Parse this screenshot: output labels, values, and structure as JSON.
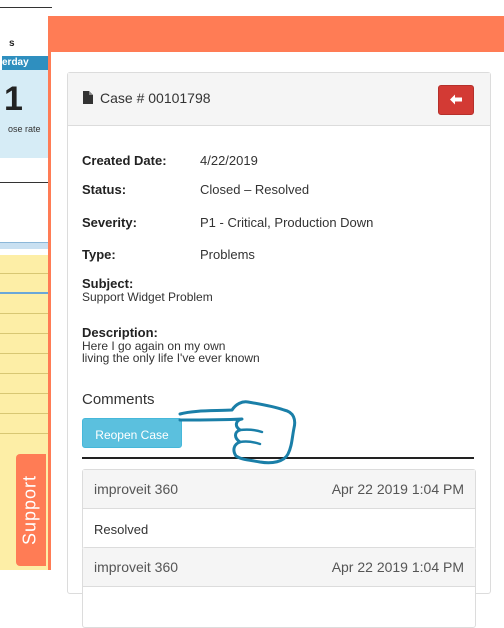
{
  "background": {
    "partial_title": "s",
    "partial_tab": "erday",
    "partial_number": "1",
    "partial_caption": "ose rate"
  },
  "support_tab": {
    "label": "Support"
  },
  "case": {
    "title": "Case # 00101798",
    "fields": {
      "created_date": {
        "label": "Created Date:",
        "value": "4/22/2019"
      },
      "status": {
        "label": "Status:",
        "value": "Closed – Resolved"
      },
      "severity": {
        "label": "Severity:",
        "value": "P1 - Critical, Production Down"
      },
      "type": {
        "label": "Type:",
        "value": "Problems"
      }
    },
    "subject": {
      "label": "Subject:",
      "value": "Support Widget Problem"
    },
    "description": {
      "label": "Description:",
      "lines": [
        "Here I go again on my own",
        "living the only life I've ever known"
      ]
    }
  },
  "comments": {
    "title": "Comments",
    "reopen_label": "Reopen Case",
    "items": [
      {
        "author": "improveit 360",
        "date": "Apr 22 2019 1:04 PM",
        "body": "Resolved"
      },
      {
        "author": "improveit 360",
        "date": "Apr 22 2019 1:04 PM",
        "body": ""
      }
    ]
  },
  "icons": {
    "document": "document-icon",
    "back": "arrow-left-icon",
    "pointer": "pointing-hand-icon"
  },
  "colors": {
    "accent": "#ff7c55",
    "danger": "#d33a34",
    "info": "#5bc0de",
    "annotation": "#1a7fa8"
  }
}
